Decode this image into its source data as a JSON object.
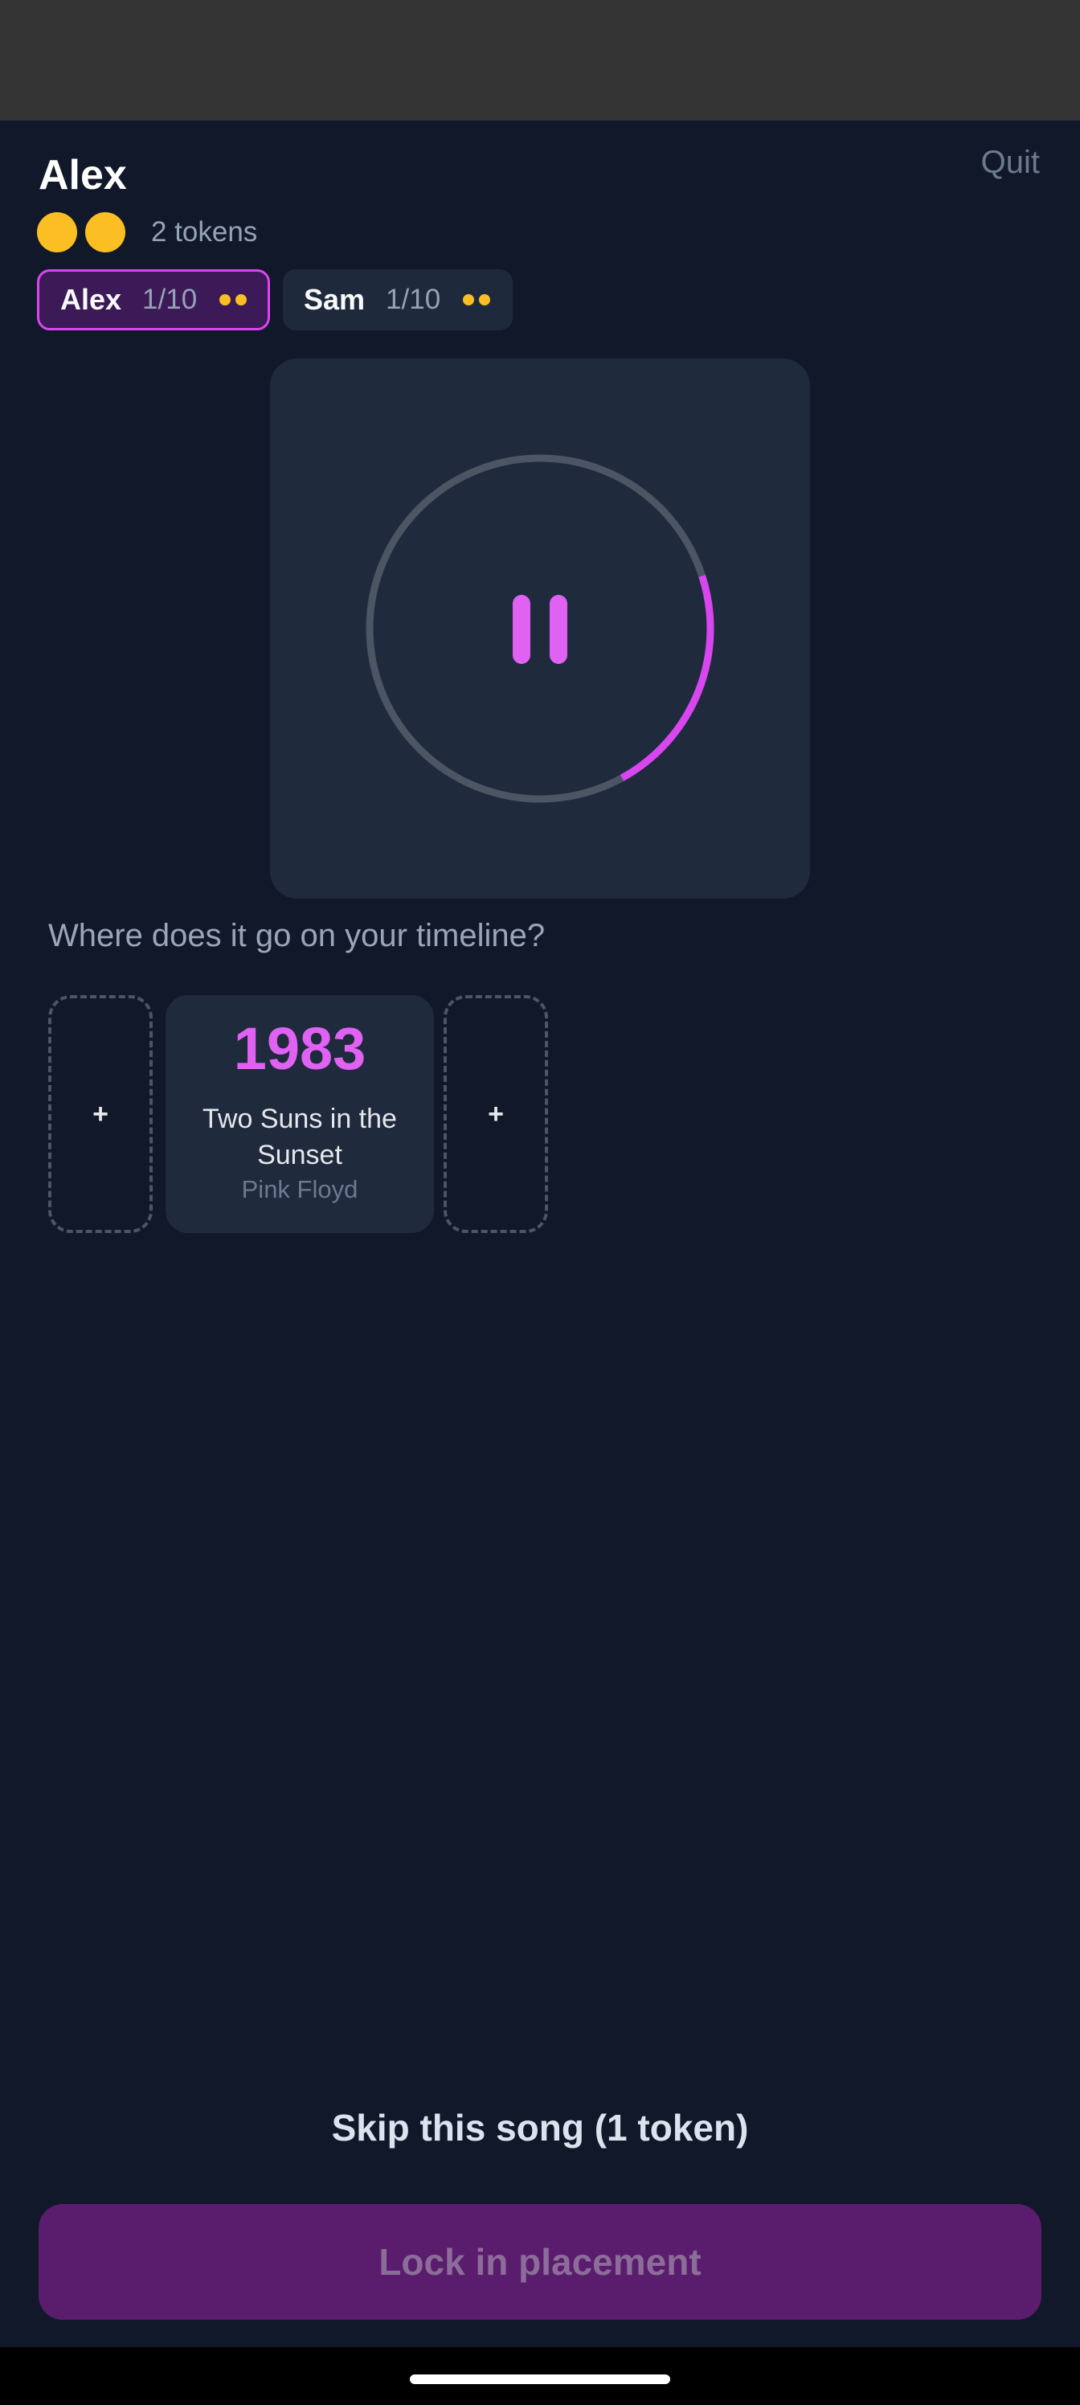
{
  "header": {
    "player_name": "Alex",
    "quit_label": "Quit",
    "token_count": 2,
    "tokens_label": "2 tokens"
  },
  "players": [
    {
      "name": "Alex",
      "score": "1/10",
      "tokens": 2,
      "active": true
    },
    {
      "name": "Sam",
      "score": "1/10",
      "tokens": 2,
      "active": false
    }
  ],
  "player": {
    "state_icon": "pause-icon",
    "progress": 0.22,
    "accent_color": "#d946ef",
    "track_color": "#4b5563"
  },
  "timeline": {
    "prompt": "Where does it go on your timeline?",
    "slot_label": "+",
    "cards": [
      {
        "year": "1983",
        "title": "Two Suns in the Sunset",
        "artist": "Pink Floyd"
      }
    ]
  },
  "actions": {
    "skip_label": "Skip this song (1 token)",
    "lock_label": "Lock in placement"
  },
  "colors": {
    "background": "#111829",
    "card": "#1f2a3d",
    "token": "#fbbf24",
    "accent": "#d946ef"
  }
}
